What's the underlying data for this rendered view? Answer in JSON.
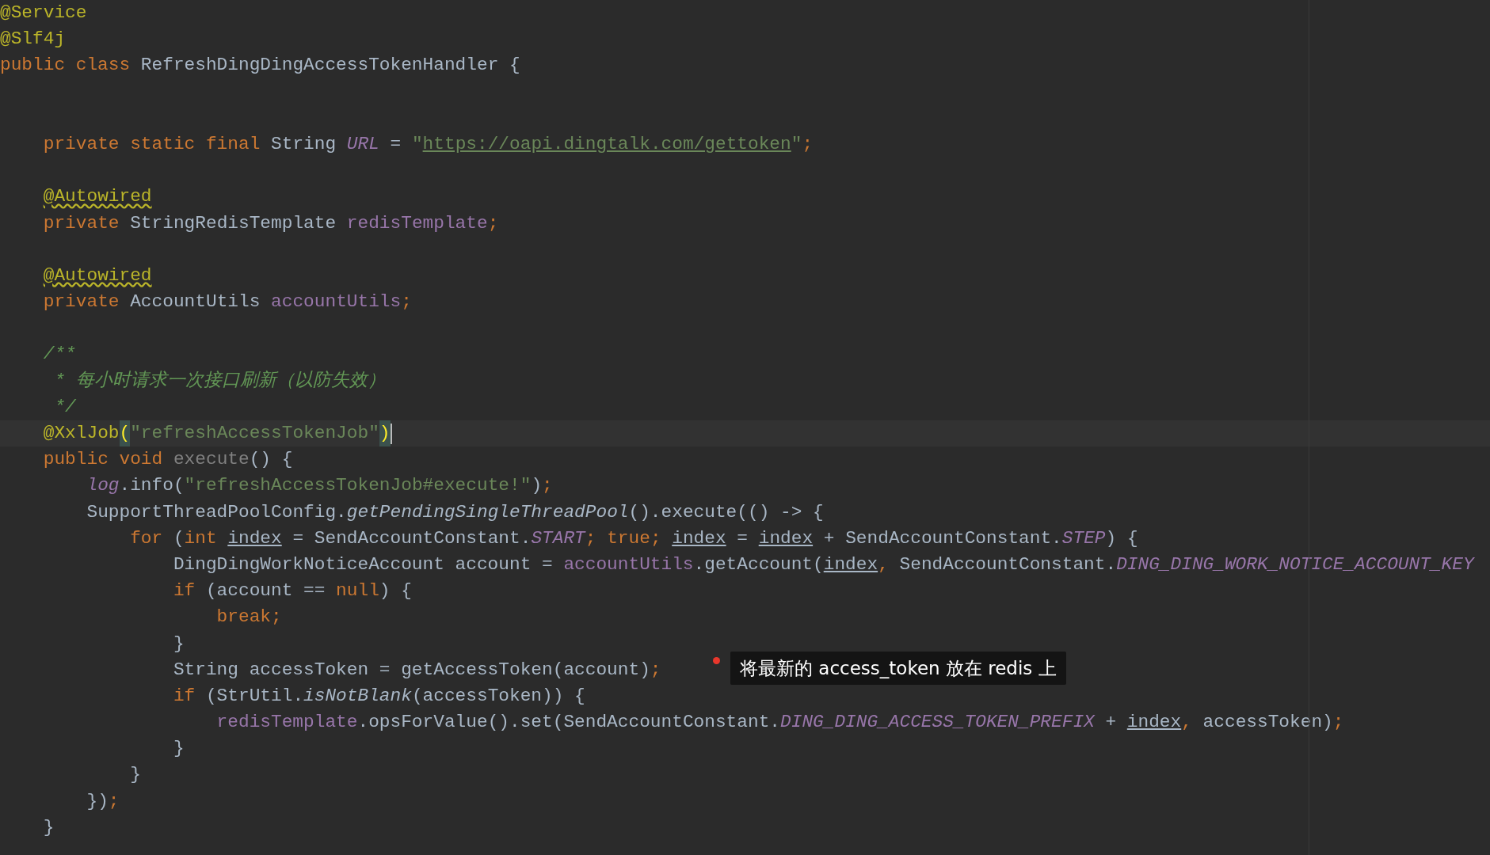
{
  "editor": {
    "lines": [
      {
        "kind": "code",
        "current": false,
        "tokens": [
          {
            "kind": "annotation",
            "text": "@Service"
          }
        ]
      },
      {
        "kind": "code",
        "current": false,
        "tokens": [
          {
            "kind": "annotation",
            "text": "@Slf4j"
          }
        ]
      },
      {
        "kind": "code",
        "current": false,
        "tokens": [
          {
            "kind": "keyword",
            "text": "public class "
          },
          {
            "kind": "plain",
            "text": "RefreshDingDingAccessTokenHandler {"
          }
        ]
      },
      {
        "kind": "blank"
      },
      {
        "kind": "blank"
      },
      {
        "kind": "code",
        "current": false,
        "tokens": [
          {
            "kind": "keyword",
            "text": "    private static final "
          },
          {
            "kind": "plain",
            "text": "String "
          },
          {
            "kind": "static",
            "text": "URL"
          },
          {
            "kind": "plain",
            "text": " = "
          },
          {
            "kind": "string",
            "text": "\""
          },
          {
            "kind": "link",
            "text": "https://oapi.dingtalk.com/gettoken"
          },
          {
            "kind": "string",
            "text": "\""
          },
          {
            "kind": "keyword",
            "text": ";"
          }
        ]
      },
      {
        "kind": "blank"
      },
      {
        "kind": "code",
        "current": false,
        "tokens": [
          {
            "kind": "warning",
            "text": "    @Autowired"
          }
        ]
      },
      {
        "kind": "code",
        "current": false,
        "tokens": [
          {
            "kind": "keyword",
            "text": "    private "
          },
          {
            "kind": "plain",
            "text": "StringRedisTemplate "
          },
          {
            "kind": "field",
            "text": "redisTemplate"
          },
          {
            "kind": "keyword",
            "text": ";"
          }
        ]
      },
      {
        "kind": "blank"
      },
      {
        "kind": "code",
        "current": false,
        "tokens": [
          {
            "kind": "warning",
            "text": "    @Autowired"
          }
        ]
      },
      {
        "kind": "code",
        "current": false,
        "tokens": [
          {
            "kind": "keyword",
            "text": "    private "
          },
          {
            "kind": "plain",
            "text": "AccountUtils "
          },
          {
            "kind": "field",
            "text": "accountUtils"
          },
          {
            "kind": "keyword",
            "text": ";"
          }
        ]
      },
      {
        "kind": "blank"
      },
      {
        "kind": "code",
        "current": false,
        "tokens": [
          {
            "kind": "doc",
            "text": "    /**"
          }
        ]
      },
      {
        "kind": "code",
        "current": false,
        "tokens": [
          {
            "kind": "doc",
            "text": "     * 每小时请求一次接口刷新（以防失效）"
          }
        ]
      },
      {
        "kind": "code",
        "current": false,
        "tokens": [
          {
            "kind": "doc",
            "text": "     */"
          }
        ]
      },
      {
        "kind": "code",
        "current": true,
        "tokens": [
          {
            "kind": "annotation",
            "text": "    @XxlJob"
          },
          {
            "kind": "match",
            "text": "("
          },
          {
            "kind": "string",
            "text": "\"refreshAccessTokenJob\""
          },
          {
            "kind": "match",
            "text": ")"
          }
        ]
      },
      {
        "kind": "code",
        "current": false,
        "tokens": [
          {
            "kind": "keyword",
            "text": "    public void "
          },
          {
            "kind": "unused",
            "text": "execute"
          },
          {
            "kind": "plain",
            "text": "() {"
          }
        ]
      },
      {
        "kind": "code",
        "current": false,
        "tokens": [
          {
            "kind": "static",
            "text": "        log"
          },
          {
            "kind": "plain",
            "text": ".info("
          },
          {
            "kind": "string",
            "text": "\"refreshAccessTokenJob#execute!\""
          },
          {
            "kind": "plain",
            "text": ")"
          },
          {
            "kind": "keyword",
            "text": ";"
          }
        ]
      },
      {
        "kind": "code",
        "current": false,
        "tokens": [
          {
            "kind": "plain",
            "text": "        SupportThreadPoolConfig."
          },
          {
            "kind": "italic",
            "text": "getPendingSingleThreadPool"
          },
          {
            "kind": "plain",
            "text": "().execute(() -> {"
          }
        ]
      },
      {
        "kind": "code",
        "current": false,
        "tokens": [
          {
            "kind": "keyword",
            "text": "            for "
          },
          {
            "kind": "plain",
            "text": "("
          },
          {
            "kind": "keyword",
            "text": "int "
          },
          {
            "kind": "variable",
            "text": "index"
          },
          {
            "kind": "plain",
            "text": " = SendAccountConstant."
          },
          {
            "kind": "static",
            "text": "START"
          },
          {
            "kind": "keyword",
            "text": "; true; "
          },
          {
            "kind": "variable",
            "text": "index"
          },
          {
            "kind": "plain",
            "text": " = "
          },
          {
            "kind": "variable",
            "text": "index"
          },
          {
            "kind": "plain",
            "text": " + SendAccountConstant."
          },
          {
            "kind": "static",
            "text": "STEP"
          },
          {
            "kind": "plain",
            "text": ") {"
          }
        ]
      },
      {
        "kind": "code",
        "current": false,
        "tokens": [
          {
            "kind": "plain",
            "text": "                DingDingWorkNoticeAccount account = "
          },
          {
            "kind": "field",
            "text": "accountUtils"
          },
          {
            "kind": "plain",
            "text": ".getAccount("
          },
          {
            "kind": "variable",
            "text": "index"
          },
          {
            "kind": "keyword",
            "text": ", "
          },
          {
            "kind": "plain",
            "text": "SendAccountConstant."
          },
          {
            "kind": "static",
            "text": "DING_DING_WORK_NOTICE_ACCOUNT_KEY"
          }
        ]
      },
      {
        "kind": "code",
        "current": false,
        "tokens": [
          {
            "kind": "keyword",
            "text": "                if "
          },
          {
            "kind": "plain",
            "text": "(account == "
          },
          {
            "kind": "keyword",
            "text": "null"
          },
          {
            "kind": "plain",
            "text": ") {"
          }
        ]
      },
      {
        "kind": "code",
        "current": false,
        "tokens": [
          {
            "kind": "keyword",
            "text": "                    break;"
          }
        ]
      },
      {
        "kind": "code",
        "current": false,
        "tokens": [
          {
            "kind": "plain",
            "text": "                }"
          }
        ]
      },
      {
        "kind": "code",
        "current": false,
        "tokens": [
          {
            "kind": "plain",
            "text": "                String accessToken = getAccessToken(account)"
          },
          {
            "kind": "keyword",
            "text": ";"
          }
        ]
      },
      {
        "kind": "code",
        "current": false,
        "tokens": [
          {
            "kind": "keyword",
            "text": "                if "
          },
          {
            "kind": "plain",
            "text": "(StrUtil."
          },
          {
            "kind": "italic",
            "text": "isNotBlank"
          },
          {
            "kind": "plain",
            "text": "(accessToken)) {"
          }
        ]
      },
      {
        "kind": "code",
        "current": false,
        "tokens": [
          {
            "kind": "field",
            "text": "                    redisTemplate"
          },
          {
            "kind": "plain",
            "text": ".opsForValue().set(SendAccountConstant."
          },
          {
            "kind": "static",
            "text": "DING_DING_ACCESS_TOKEN_PREFIX"
          },
          {
            "kind": "plain",
            "text": " + "
          },
          {
            "kind": "variable",
            "text": "index"
          },
          {
            "kind": "keyword",
            "text": ", "
          },
          {
            "kind": "plain",
            "text": "accessToken)"
          },
          {
            "kind": "keyword",
            "text": ";"
          }
        ]
      },
      {
        "kind": "code",
        "current": false,
        "tokens": [
          {
            "kind": "plain",
            "text": "                }"
          }
        ]
      },
      {
        "kind": "code",
        "current": false,
        "tokens": [
          {
            "kind": "plain",
            "text": "            }"
          }
        ]
      },
      {
        "kind": "code",
        "current": false,
        "tokens": [
          {
            "kind": "plain",
            "text": "        })"
          },
          {
            "kind": "keyword",
            "text": ";"
          }
        ]
      },
      {
        "kind": "code",
        "current": false,
        "tokens": [
          {
            "kind": "plain",
            "text": "    }"
          }
        ]
      }
    ]
  },
  "tooltip": {
    "text": "将最新的 access_token 放在 redis 上"
  }
}
